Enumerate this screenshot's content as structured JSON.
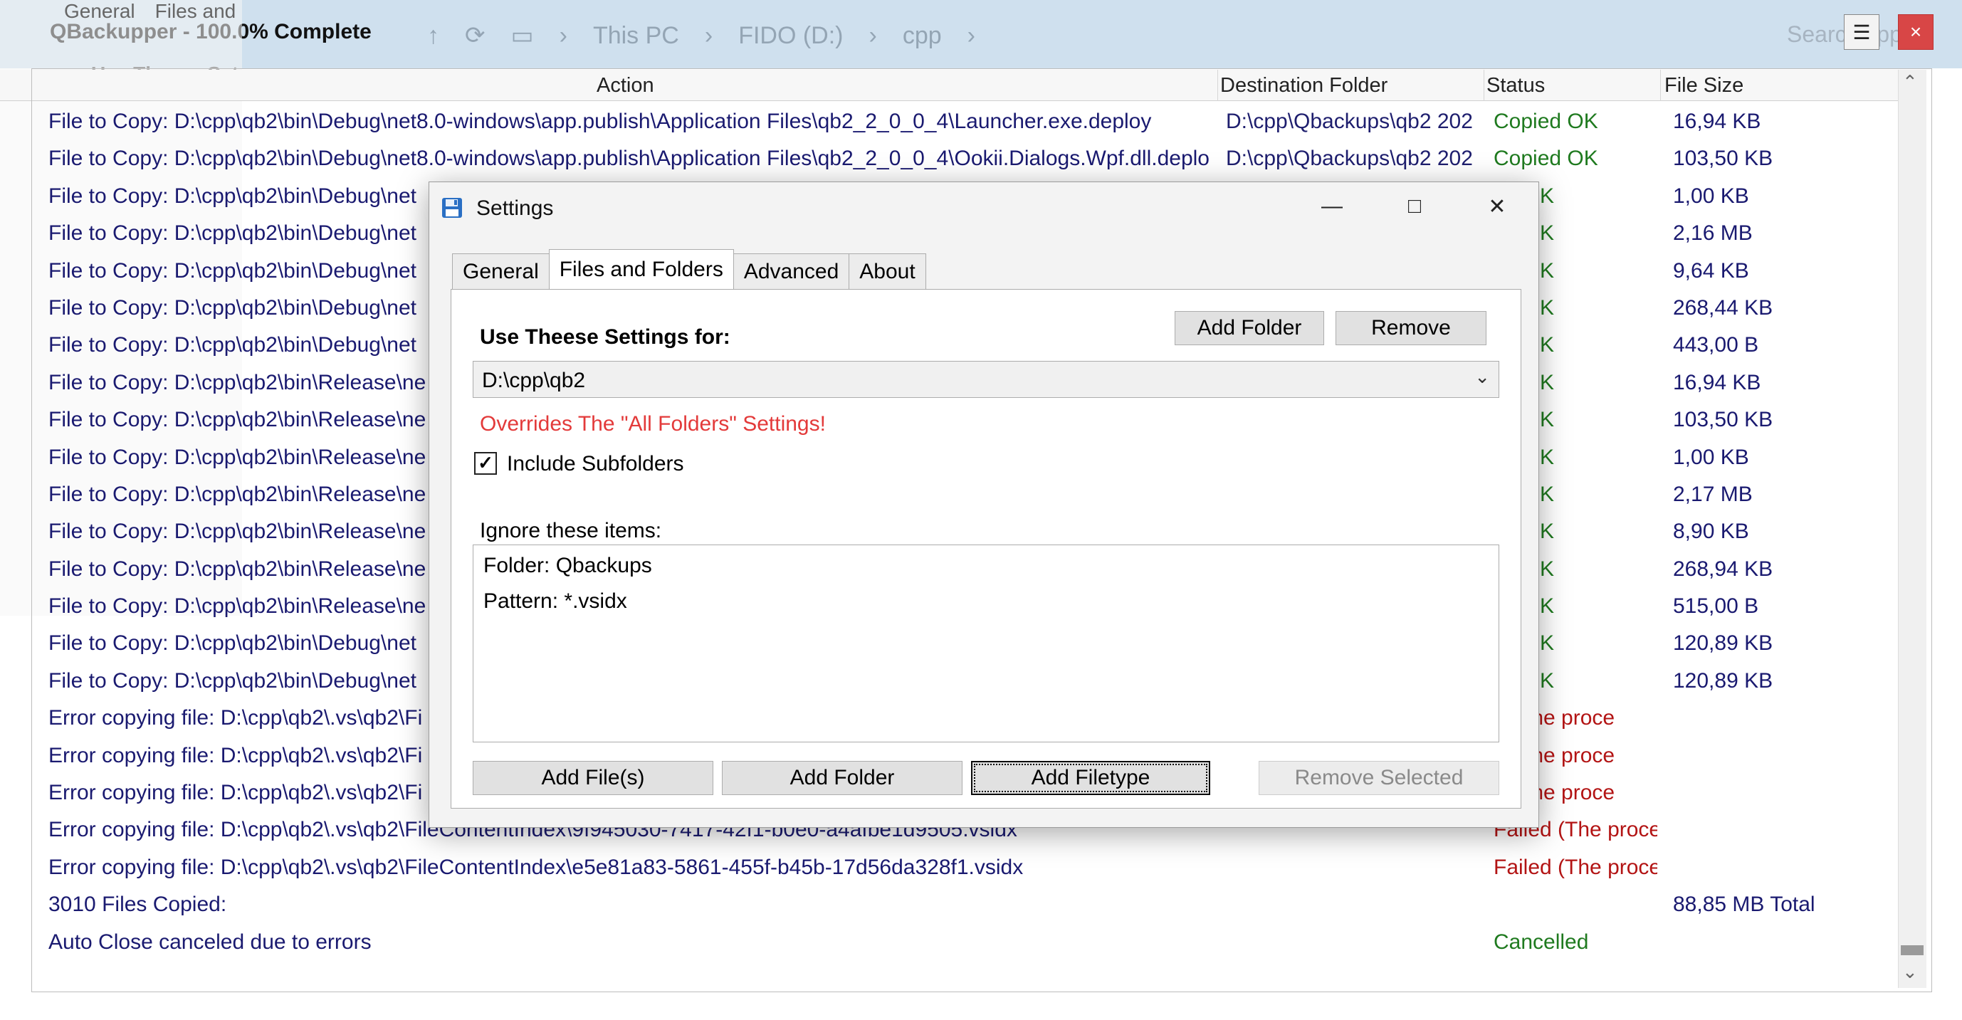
{
  "app": {
    "title": "QBackupper - 100.0% Complete",
    "bg_tabs": [
      "General",
      "Files and"
    ],
    "bg_use_label": "Use Theese Set",
    "menu_icon": "hamburger-icon",
    "close_icon": "close-icon"
  },
  "bg_explorer": {
    "crumbs": [
      "↑",
      "⟳",
      "▭",
      "›",
      "This PC",
      "›",
      "FIDO (D:)",
      "›",
      "cpp",
      "›"
    ],
    "search_placeholder": "Search cpp"
  },
  "columns": [
    "Action",
    "Destination Folder",
    "Status",
    "File Size"
  ],
  "rows": [
    {
      "action": "File to Copy: D:\\cpp\\qb2\\bin\\Debug\\net8.0-windows\\app.publish\\Application Files\\qb2_2_0_0_4\\Launcher.exe.deploy",
      "dest": "D:\\cpp\\Qbackups\\qb2 202",
      "status": "Copied OK",
      "size": "16,94 KB",
      "kind": "ok"
    },
    {
      "action": "File to Copy: D:\\cpp\\qb2\\bin\\Debug\\net8.0-windows\\app.publish\\Application Files\\qb2_2_0_0_4\\Ookii.Dialogs.Wpf.dll.deplo",
      "dest": "D:\\cpp\\Qbackups\\qb2 202",
      "status": "Copied OK",
      "size": "103,50 KB",
      "kind": "ok"
    },
    {
      "action": "File to Copy: D:\\cpp\\qb2\\bin\\Debug\\net",
      "dest": "",
      "status": "ed OK",
      "size": "1,00 KB",
      "kind": "ok"
    },
    {
      "action": "File to Copy: D:\\cpp\\qb2\\bin\\Debug\\net",
      "dest": "",
      "status": "ed OK",
      "size": "2,16 MB",
      "kind": "ok"
    },
    {
      "action": "File to Copy: D:\\cpp\\qb2\\bin\\Debug\\net",
      "dest": "",
      "status": "ed OK",
      "size": "9,64 KB",
      "kind": "ok"
    },
    {
      "action": "File to Copy: D:\\cpp\\qb2\\bin\\Debug\\net",
      "dest": "",
      "status": "ed OK",
      "size": "268,44 KB",
      "kind": "ok"
    },
    {
      "action": "File to Copy: D:\\cpp\\qb2\\bin\\Debug\\net",
      "dest": "",
      "status": "ed OK",
      "size": "443,00 B",
      "kind": "ok"
    },
    {
      "action": "File to Copy: D:\\cpp\\qb2\\bin\\Release\\ne",
      "dest": "",
      "status": "ed OK",
      "size": "16,94 KB",
      "kind": "ok"
    },
    {
      "action": "File to Copy: D:\\cpp\\qb2\\bin\\Release\\ne",
      "dest": "",
      "status": "ed OK",
      "size": "103,50 KB",
      "kind": "ok"
    },
    {
      "action": "File to Copy: D:\\cpp\\qb2\\bin\\Release\\ne",
      "dest": "",
      "status": "ed OK",
      "size": "1,00 KB",
      "kind": "ok"
    },
    {
      "action": "File to Copy: D:\\cpp\\qb2\\bin\\Release\\ne",
      "dest": "",
      "status": "ed OK",
      "size": "2,17 MB",
      "kind": "ok"
    },
    {
      "action": "File to Copy: D:\\cpp\\qb2\\bin\\Release\\ne",
      "dest": "",
      "status": "ed OK",
      "size": "8,90 KB",
      "kind": "ok"
    },
    {
      "action": "File to Copy: D:\\cpp\\qb2\\bin\\Release\\ne",
      "dest": "",
      "status": "ed OK",
      "size": "268,94 KB",
      "kind": "ok"
    },
    {
      "action": "File to Copy: D:\\cpp\\qb2\\bin\\Release\\ne",
      "dest": "",
      "status": "ed OK",
      "size": "515,00 B",
      "kind": "ok"
    },
    {
      "action": "File to Copy: D:\\cpp\\qb2\\bin\\Debug\\net",
      "dest": "",
      "status": "ed OK",
      "size": "120,89 KB",
      "kind": "ok"
    },
    {
      "action": "File to Copy: D:\\cpp\\qb2\\bin\\Debug\\net",
      "dest": "",
      "status": "ed OK",
      "size": "120,89 KB",
      "kind": "ok"
    },
    {
      "action": "Error copying file: D:\\cpp\\qb2\\.vs\\qb2\\Fi",
      "dest": "",
      "status": "d (The proce",
      "size": "",
      "kind": "err"
    },
    {
      "action": "Error copying file: D:\\cpp\\qb2\\.vs\\qb2\\Fi",
      "dest": "",
      "status": "d (The proce",
      "size": "",
      "kind": "err"
    },
    {
      "action": "Error copying file: D:\\cpp\\qb2\\.vs\\qb2\\Fi",
      "dest": "",
      "status": "d (The proce",
      "size": "",
      "kind": "err"
    },
    {
      "action": "Error copying file: D:\\cpp\\qb2\\.vs\\qb2\\FileContentIndex\\9f945030-7417-42f1-b0e0-a4afbe1d9505.vsidx",
      "dest": "",
      "status": "Failed (The proce",
      "size": "",
      "kind": "err"
    },
    {
      "action": "Error copying file: D:\\cpp\\qb2\\.vs\\qb2\\FileContentIndex\\e5e81a83-5861-455f-b45b-17d56da328f1.vsidx",
      "dest": "",
      "status": "Failed (The proce",
      "size": "",
      "kind": "err"
    },
    {
      "action": "3010 Files Copied:",
      "dest": "",
      "status": "",
      "size": "88,85 MB Total",
      "kind": "sum"
    },
    {
      "action": "Auto Close canceled due to errors",
      "dest": "",
      "status": "Cancelled",
      "size": "",
      "kind": "cancel"
    }
  ],
  "dialog": {
    "title": "Settings",
    "icon": "floppy-disk-icon",
    "controls": {
      "minimize": "—",
      "maximize": "□",
      "close": "✕"
    },
    "tabs": [
      {
        "label": "General",
        "active": false
      },
      {
        "label": "Files and Folders",
        "active": true
      },
      {
        "label": "Advanced",
        "active": false
      },
      {
        "label": "About",
        "active": false
      }
    ],
    "use_label": "Use Theese Settings for:",
    "top_add_folder": "Add Folder",
    "top_remove": "Remove",
    "folder_selected": "D:\\cpp\\qb2",
    "overrides_warning": "Overrides The \"All Folders\" Settings!",
    "include_subfolders_label": "Include Subfolders",
    "include_subfolders_checked": true,
    "ignore_label": "Ignore these items:",
    "ignore_items": [
      "Folder: Qbackups",
      "Pattern: *.vsidx"
    ],
    "btn_add_files": "Add File(s)",
    "btn_add_folder": "Add Folder",
    "btn_add_filetype": "Add Filetype",
    "btn_remove_selected": "Remove Selected"
  },
  "colors": {
    "ok": "#1f7a1f",
    "error": "#b31414",
    "warning": "#e33a3a",
    "close": "#d84646"
  }
}
